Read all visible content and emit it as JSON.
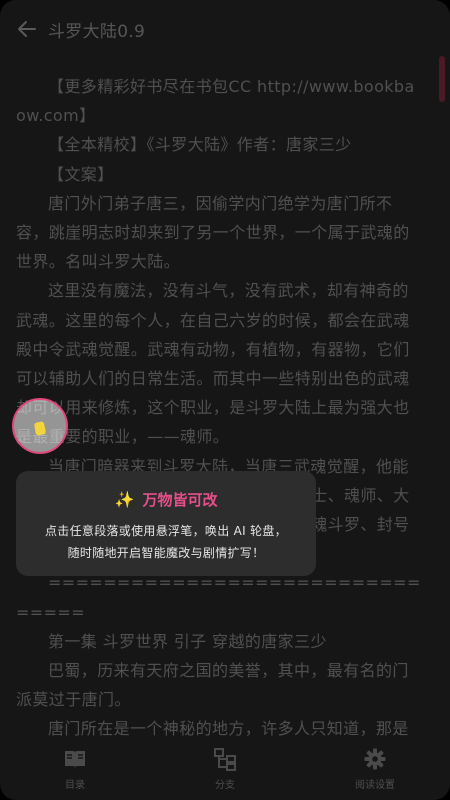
{
  "header": {
    "back_icon": "arrow-left-icon",
    "title": "斗罗大陆0.9"
  },
  "content": {
    "paragraphs": [
      "【更多精彩好书尽在书包CC http://www.bookbaow.com】",
      "【全本精校】《斗罗大陆》作者：唐家三少",
      "【文案】",
      "唐门外门弟子唐三，因偷学内门绝学为唐门所不容，跳崖明志时却来到了另一个世界，一个属于武魂的世界。名叫斗罗大陆。",
      "这里没有魔法，没有斗气，没有武术，却有神奇的武魂。这里的每个人，在自己六岁的时候，都会在武魂殿中令武魂觉醒。武魂有动物，有植物，有器物，它们可以辅助人们的日常生活。而其中一些特别出色的武魂却可以用来修炼，这个职业，是斗罗大陆上最为强大也是最重要的职业，——魂师。",
      "当唐门暗器来到斗罗大陆，当唐三武魂觉醒，他能否在这片武魂的世界再铸唐门的辉煌？魂士、魂师、大魂师、魂尊、魂宗、魂王、魂帝、魂圣、魂斗罗、封号斗罗。",
      "================================",
      "第一集 斗罗世界 引子 穿越的唐家三少",
      "巴蜀，历来有天府之国的美誉，其中，最有名的门派莫过于唐门。",
      "唐门所在是一个神秘的地方，许多人只知道，那是一个半山腰，而唐门所在这座山的山顶有一个令人胆颤心惊的地方，被称为鬼见愁。"
    ]
  },
  "tooltip": {
    "icon": "sparkle-icon",
    "icon_glyph": "✨",
    "title": "万物皆可改",
    "line1": "点击任意段落或使用悬浮笔，唤出 AI 轮盘，",
    "line2": "随时随地开启智能魔改与剧情扩写！"
  },
  "bottom_bar": {
    "tabs": [
      {
        "icon": "book-icon",
        "label": "目录"
      },
      {
        "icon": "branch-icon",
        "label": "分支"
      },
      {
        "icon": "gear-icon",
        "label": "阅读设置"
      }
    ]
  },
  "colors": {
    "background": "#161616",
    "text": "#505050",
    "accent": "#e6508a",
    "tooltip_bg": "#2d2d2d"
  }
}
